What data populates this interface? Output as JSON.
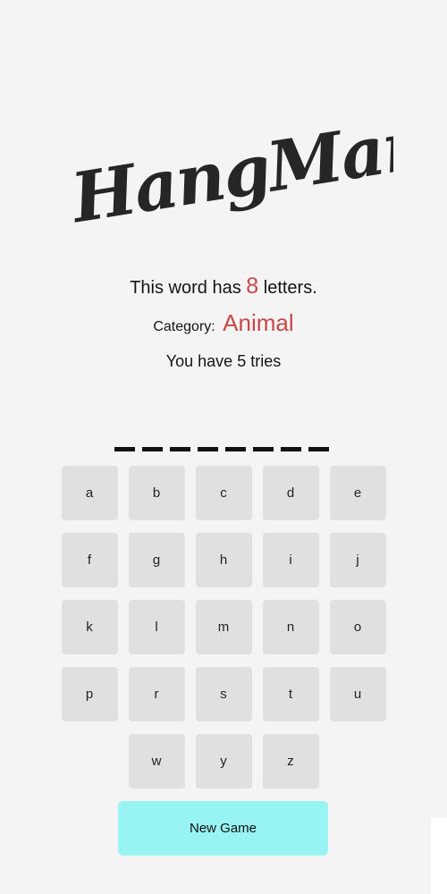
{
  "logo": {
    "text": "HangMan"
  },
  "info": {
    "letters_prefix": "This word has",
    "letters_count": "8",
    "letters_suffix": "letters.",
    "category_label": "Category:",
    "category_value": "Animal",
    "tries_text": "You have 5 tries"
  },
  "word": {
    "length": 8
  },
  "keyboard": {
    "rows": [
      [
        "a",
        "b",
        "c",
        "d",
        "e"
      ],
      [
        "f",
        "g",
        "h",
        "i",
        "j"
      ],
      [
        "k",
        "l",
        "m",
        "n",
        "o"
      ],
      [
        "p",
        "r",
        "s",
        "t",
        "u"
      ],
      [
        "w",
        "y",
        "z"
      ]
    ]
  },
  "actions": {
    "new_game_label": "New Game"
  },
  "colors": {
    "accent_red": "#c9494b",
    "new_game_bg": "#98f4f2",
    "key_bg": "#e0e0e0"
  }
}
